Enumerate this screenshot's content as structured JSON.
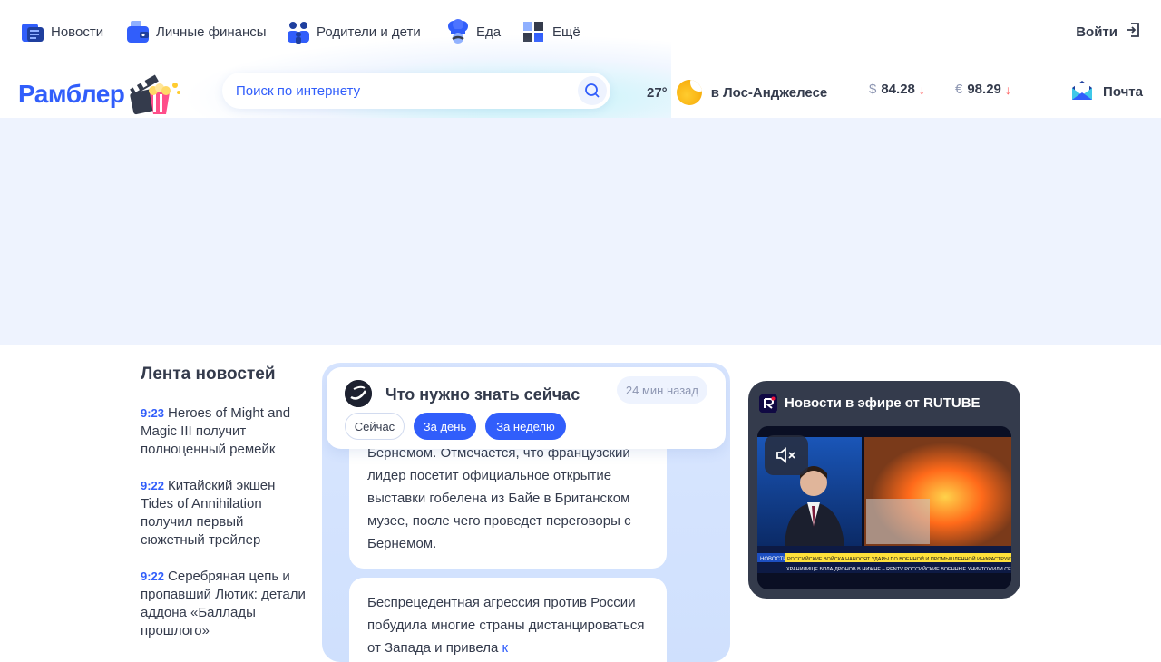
{
  "topnav": {
    "items": [
      {
        "label": "Новости",
        "icon": "newspaper-icon"
      },
      {
        "label": "Личные финансы",
        "icon": "wallet-icon"
      },
      {
        "label": "Родители и дети",
        "icon": "family-icon"
      },
      {
        "label": "Еда",
        "icon": "chef-icon"
      },
      {
        "label": "Ещё",
        "icon": "grid-icon"
      }
    ],
    "login_label": "Войти"
  },
  "header": {
    "logo_text": "Рамблер",
    "search_placeholder": "Поиск по интернету",
    "weather": {
      "temp": "27°",
      "city": "в Лос-Анджелесе",
      "icon": "moon-icon"
    },
    "rates": [
      {
        "symbol": "$",
        "value": "84.28",
        "trend": "↓"
      },
      {
        "symbol": "€",
        "value": "98.29",
        "trend": "↓"
      }
    ],
    "mail_label": "Почта"
  },
  "feed": {
    "title": "Лента новостей",
    "items": [
      {
        "time": "9:23",
        "text": "Heroes of Might and Magic III получит полноценный ремейк"
      },
      {
        "time": "9:22",
        "text": "Китайский экшен Tides of Annihilation получил первый сюжетный трейлер"
      },
      {
        "time": "9:22",
        "text": "Серебряная цепь и пропавший Лютик: детали аддона «Баллады прошлого»"
      }
    ]
  },
  "story": {
    "sticky_title": "Что нужно знать сейчас",
    "sticky_time": "24 мин назад",
    "chips": [
      "Сейчас",
      "За день",
      "За неделю"
    ],
    "card1_text": "Бернемом. Отмечается, что французский лидер посетит официальное открытие выставки гобелена из Байе в Британском музее, после чего проведет переговоры с Бернемом.",
    "card2_text": "Беспрецедентная агрессия против России побудила многие страны дистанцироваться от Запада и привела ",
    "card2_link": "к"
  },
  "rutube": {
    "title": "Новости в эфире от RUTUBE",
    "ticker_label": "НОВОСТИ",
    "ticker_headline": "РОССИЙСКИЕ ВОЙСКА НАНОСЯТ УДАРЫ ПО ВОЕННОЙ И ПРОМЫШЛЕННОЙ ИНФРАСТРУКТУРЕ УКРАИНЫ",
    "ticker_bottom": "ХРАНИЛИЩЕ БПЛА-ДРОНОВ В НИЖНЕ – RENTV    РОССИЙСКИЕ ВОЕННЫЕ УНИЧТОЖИЛИ СЕ"
  },
  "colors": {
    "brand": "#315efb",
    "text": "#343b4c",
    "muted": "#8d96b2",
    "down": "#ff5b5b",
    "banner_bg": "#eef3fe",
    "widget_bg": "#343b4c"
  }
}
